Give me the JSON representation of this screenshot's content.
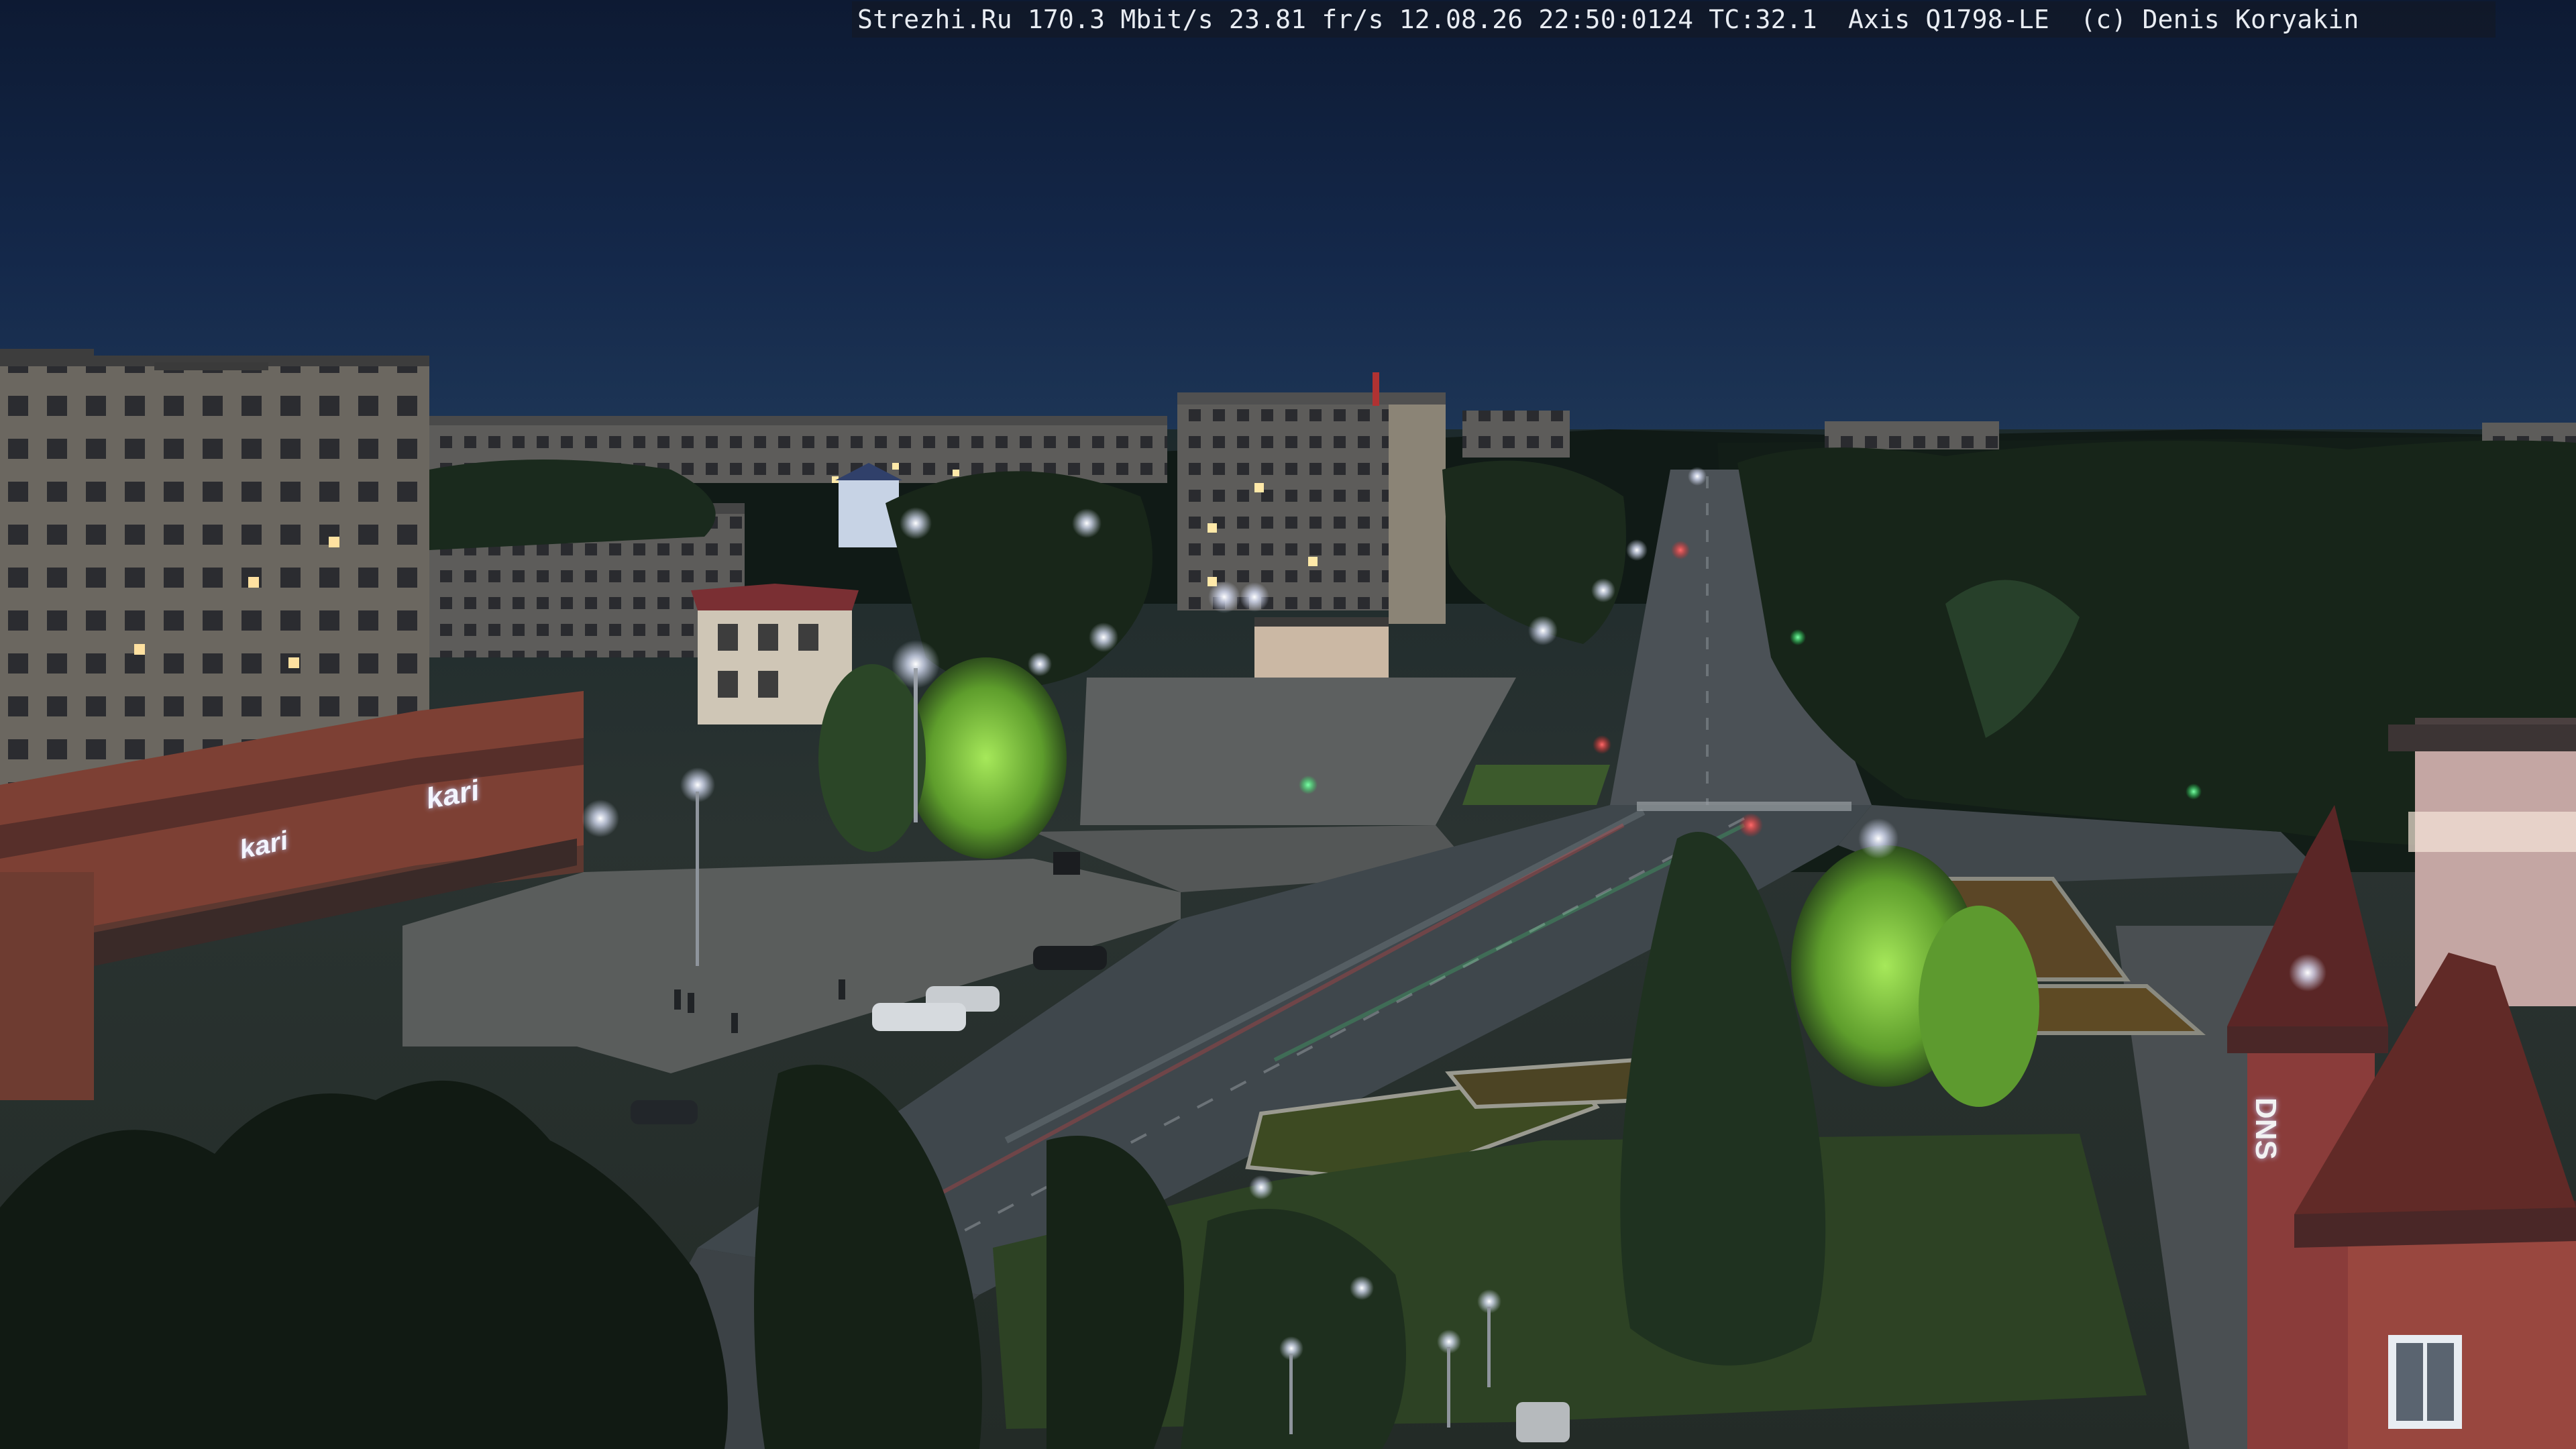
{
  "camera_overlay": {
    "text": "Strezhi.Ru 170.3 Mbit/s 23.81 fr/s 12.08.26 22:50:0124 TC:32.1  Axis Q1798-LE  (c) Denis Koryakin",
    "site": "Strezhi.Ru",
    "bitrate": "170.3 Mbit/s",
    "frame_rate": "23.81 fr/s",
    "date": "12.08.26",
    "time": "22:50:0124",
    "tc": "TC:32.1",
    "camera_model": "Axis Q1798-LE",
    "copyright": "(c) Denis Koryakin"
  },
  "signs": {
    "kari_storefront": "kari",
    "kari_lower": "kari",
    "side_building": "DNS"
  },
  "colors": {
    "sky_top": "#0d1a33",
    "sky_horizon": "#1f3858",
    "streetlight_glow": "#dfe6ff",
    "traffic_red": "#ff3030",
    "traffic_green": "#2cff6a",
    "foliage_lit": "#7fcf3a",
    "foliage_dark": "#18231a",
    "road": "#3f474c",
    "plaza": "#5a5d5c"
  }
}
